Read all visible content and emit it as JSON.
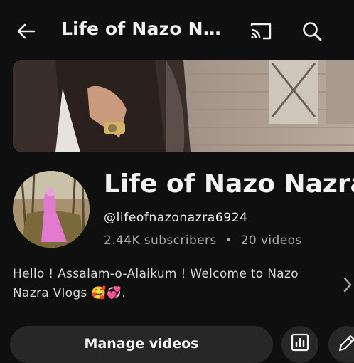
{
  "header": {
    "title": "Life of Nazo Na...",
    "back_icon": "arrow-left-icon",
    "cast_icon": "cast-icon",
    "search_icon": "search-icon"
  },
  "channel": {
    "name": "Life of Nazo Nazra",
    "handle": "@lifeofnazonazra6924",
    "subscribers": "2.44K subscribers",
    "separator": "•",
    "videos": "20 videos",
    "description_line1": "Hello ! Assalam-o-Alaikum ! Welcome to Nazo",
    "description_line2": "Nazra Vlogs 🥰💞."
  },
  "actions": {
    "manage_label": "Manage videos",
    "analytics_icon": "analytics-icon",
    "edit_icon": "pencil-icon"
  },
  "colors": {
    "background": "#0f0f0f",
    "button_bg": "#272727",
    "secondary_text": "#aaaaaa"
  }
}
